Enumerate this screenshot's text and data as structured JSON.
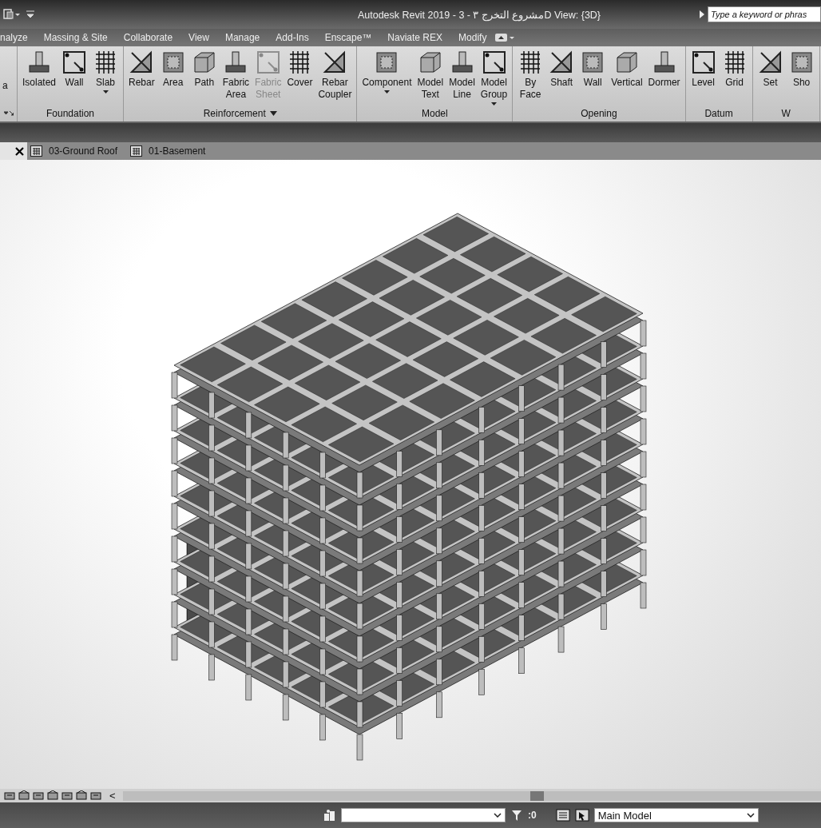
{
  "window": {
    "title": "Autodesk Revit 2019 - مشروع التخرج ٣ - 3D View: {3D}"
  },
  "search": {
    "placeholder": "Type a keyword or phras"
  },
  "menu_tabs": [
    "nalyze",
    "Massing & Site",
    "Collaborate",
    "View",
    "Manage",
    "Add-Ins",
    "Enscape™",
    "Naviate REX",
    "Modify"
  ],
  "ribbon": {
    "groups": [
      {
        "tools": [
          {
            "label": "a",
            "dropdown": false,
            "disabled": false
          }
        ]
      },
      {
        "label": "Foundation",
        "dropdown": false,
        "tools": [
          {
            "label": "Isolated",
            "dropdown": false,
            "disabled": false
          },
          {
            "label": "Wall",
            "dropdown": false,
            "disabled": false
          },
          {
            "label": "Slab",
            "dropdown": true,
            "disabled": false
          }
        ]
      },
      {
        "label": "Reinforcement",
        "dropdown": true,
        "tools": [
          {
            "label": "Rebar",
            "dropdown": false,
            "disabled": false
          },
          {
            "label": "Area",
            "dropdown": false,
            "disabled": false
          },
          {
            "label": "Path",
            "dropdown": false,
            "disabled": false
          },
          {
            "label": "Fabric Area",
            "dropdown": false,
            "disabled": false
          },
          {
            "label": "Fabric Sheet",
            "dropdown": false,
            "disabled": true
          },
          {
            "label": "Cover",
            "dropdown": false,
            "disabled": false
          },
          {
            "label": "Rebar Coupler",
            "dropdown": false,
            "disabled": false
          }
        ]
      },
      {
        "label": "Model",
        "dropdown": false,
        "tools": [
          {
            "label": "Component",
            "dropdown": true,
            "disabled": false
          },
          {
            "label": "Model Text",
            "dropdown": false,
            "disabled": false
          },
          {
            "label": "Model Line",
            "dropdown": false,
            "disabled": false
          },
          {
            "label": "Model Group",
            "dropdown": true,
            "disabled": false
          }
        ]
      },
      {
        "label": "Opening",
        "dropdown": false,
        "tools": [
          {
            "label": "By Face",
            "dropdown": false,
            "disabled": false
          },
          {
            "label": "Shaft",
            "dropdown": false,
            "disabled": false
          },
          {
            "label": "Wall",
            "dropdown": false,
            "disabled": false
          },
          {
            "label": "Vertical",
            "dropdown": false,
            "disabled": false
          },
          {
            "label": "Dormer",
            "dropdown": false,
            "disabled": false
          }
        ]
      },
      {
        "label": "Datum",
        "dropdown": false,
        "tools": [
          {
            "label": "Level",
            "dropdown": false,
            "disabled": false
          },
          {
            "label": "Grid",
            "dropdown": false,
            "disabled": false
          }
        ]
      },
      {
        "label": "W",
        "dropdown": false,
        "tools": [
          {
            "label": "Set",
            "dropdown": false,
            "disabled": false
          },
          {
            "label": "Sho",
            "dropdown": false,
            "disabled": false
          }
        ]
      }
    ]
  },
  "view_tabs": [
    {
      "label": "03-Ground Roof",
      "selected": false
    },
    {
      "label": "01-Basement",
      "selected": false
    }
  ],
  "view_control_bar": {
    "collapse": "<"
  },
  "status_bar": {
    "filter_count": ":0",
    "design_option": "Main Model"
  }
}
